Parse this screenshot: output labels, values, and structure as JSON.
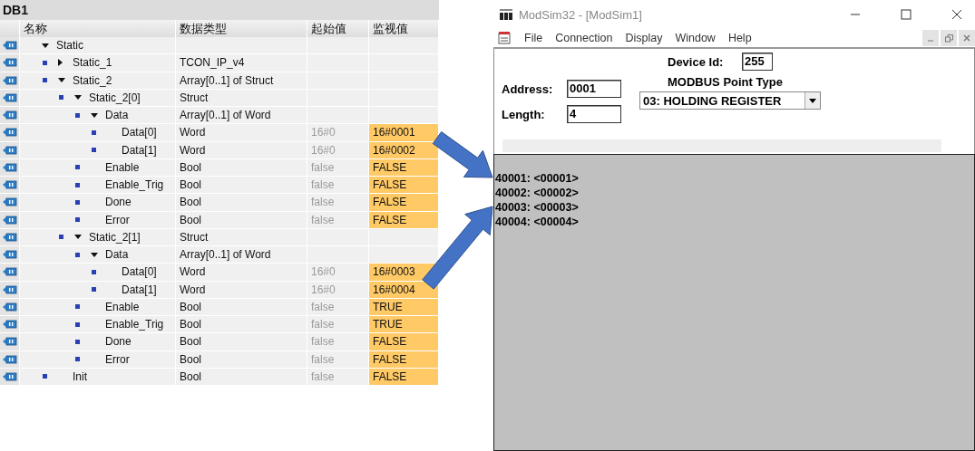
{
  "db_panel": {
    "title": "DB1",
    "columns": [
      "名称",
      "数据类型",
      "起始值",
      "监视值"
    ],
    "rows": [
      {
        "name": "Static",
        "expanded": true,
        "children": [
          {
            "name": "Static_1",
            "type": "TCON_IP_v4",
            "expanded": false
          },
          {
            "name": "Static_2",
            "type": "Array[0..1] of Struct",
            "expanded": true,
            "children": [
              {
                "name": "Static_2[0]",
                "type": "Struct",
                "expanded": true,
                "children": [
                  {
                    "name": "Data",
                    "type": "Array[0..1] of Word",
                    "expanded": true,
                    "children": [
                      {
                        "name": "Data[0]",
                        "type": "Word",
                        "start": "16#0",
                        "monitor": "16#0001"
                      },
                      {
                        "name": "Data[1]",
                        "type": "Word",
                        "start": "16#0",
                        "monitor": "16#0002"
                      }
                    ]
                  },
                  {
                    "name": "Enable",
                    "type": "Bool",
                    "start": "false",
                    "monitor": "FALSE"
                  },
                  {
                    "name": "Enable_Trig",
                    "type": "Bool",
                    "start": "false",
                    "monitor": "FALSE"
                  },
                  {
                    "name": "Done",
                    "type": "Bool",
                    "start": "false",
                    "monitor": "FALSE"
                  },
                  {
                    "name": "Error",
                    "type": "Bool",
                    "start": "false",
                    "monitor": "FALSE"
                  }
                ]
              },
              {
                "name": "Static_2[1]",
                "type": "Struct",
                "expanded": true,
                "children": [
                  {
                    "name": "Data",
                    "type": "Array[0..1] of Word",
                    "expanded": true,
                    "children": [
                      {
                        "name": "Data[0]",
                        "type": "Word",
                        "start": "16#0",
                        "monitor": "16#0003"
                      },
                      {
                        "name": "Data[1]",
                        "type": "Word",
                        "start": "16#0",
                        "monitor": "16#0004"
                      }
                    ]
                  },
                  {
                    "name": "Enable",
                    "type": "Bool",
                    "start": "false",
                    "monitor": "TRUE"
                  },
                  {
                    "name": "Enable_Trig",
                    "type": "Bool",
                    "start": "false",
                    "monitor": "TRUE"
                  },
                  {
                    "name": "Done",
                    "type": "Bool",
                    "start": "false",
                    "monitor": "FALSE"
                  },
                  {
                    "name": "Error",
                    "type": "Bool",
                    "start": "false",
                    "monitor": "FALSE"
                  }
                ]
              }
            ]
          },
          {
            "name": "Init",
            "type": "Bool",
            "start": "false",
            "monitor": "FALSE"
          }
        ]
      }
    ]
  },
  "modsim": {
    "window": {
      "title": "ModSim32 - [ModSim1]"
    },
    "menu": [
      "File",
      "Connection",
      "Display",
      "Window",
      "Help"
    ],
    "device_id": {
      "label": "Device Id:",
      "value": "255"
    },
    "address": {
      "label": "Address:",
      "value": "0001"
    },
    "length": {
      "label": "Length:",
      "value": "4"
    },
    "point_type": {
      "label": "MODBUS Point Type",
      "value": "03: HOLDING REGISTER"
    },
    "registers": [
      "40001: <00001>",
      "40002: <00002>",
      "40003: <00003>",
      "40004: <00004>"
    ]
  }
}
